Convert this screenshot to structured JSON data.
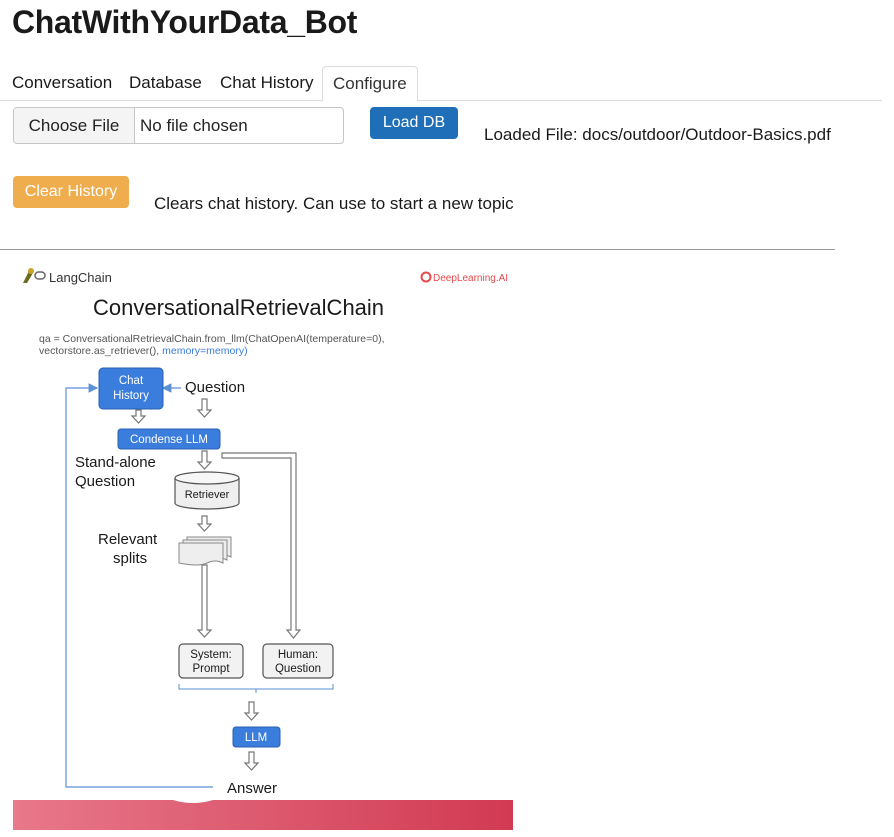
{
  "app": {
    "title": "ChatWithYourData_Bot"
  },
  "tabs": [
    {
      "label": "Conversation"
    },
    {
      "label": "Database"
    },
    {
      "label": "Chat History"
    },
    {
      "label": "Configure",
      "active": true
    }
  ],
  "file_input": {
    "button_label": "Choose File",
    "status": "No file chosen"
  },
  "load_db": {
    "label": "Load DB"
  },
  "loaded_file": {
    "text": "Loaded File: docs/outdoor/Outdoor-Basics.pdf"
  },
  "clear_history": {
    "label": "Clear History",
    "description": "Clears chat history. Can use to start a new topic"
  },
  "colors": {
    "load_db": "#1f6fb8",
    "clear_history": "#f0ad4e",
    "node_blue": "#3b7ddd"
  },
  "diagram": {
    "logo_left": "LangChain",
    "logo_right": "DeepLearning.AI",
    "title": "ConversationalRetrievalChain",
    "code_line1": "qa = ConversationalRetrievalChain.from_llm(ChatOpenAI(temperature=0),",
    "code_line2_plain": "vectorstore.as_retriever(), ",
    "code_line2_highlight": "memory=memory)",
    "chat_history_line1": "Chat",
    "chat_history_line2": "History",
    "question": "Question",
    "condense_llm": "Condense LLM",
    "standalone_line1": "Stand-alone",
    "standalone_line2": "Question",
    "retriever": "Retriever",
    "relevant_line1": "Relevant",
    "relevant_line2": "splits",
    "system_line1": "System:",
    "system_line2": "Prompt",
    "human_line1": "Human:",
    "human_line2": "Question",
    "llm": "LLM",
    "answer": "Answer"
  }
}
